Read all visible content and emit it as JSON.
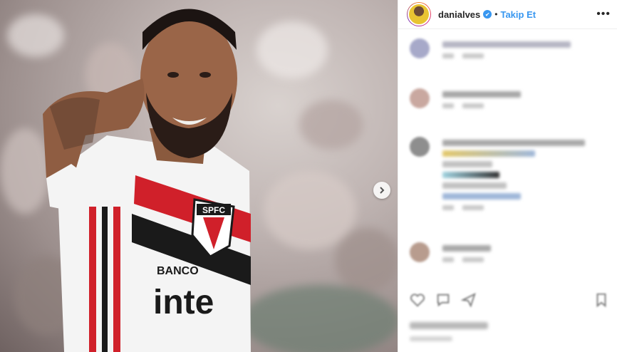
{
  "header": {
    "username": "danialves",
    "separator": "•",
    "follow_label": "Takip Et",
    "more_label": "•••",
    "verified_mark": "✔"
  },
  "photo": {
    "jersey_badge": "SPFC",
    "sponsor_top": "BANCO",
    "sponsor_main": "inte"
  },
  "colors": {
    "accent": "#3897f0",
    "jersey_red": "#d0202a",
    "jersey_black": "#1a1a1a"
  },
  "icons": {
    "next": "chevron-right-icon",
    "like": "heart-icon",
    "comment": "comment-icon",
    "share": "share-icon",
    "save": "bookmark-icon",
    "more": "more-options-icon"
  }
}
